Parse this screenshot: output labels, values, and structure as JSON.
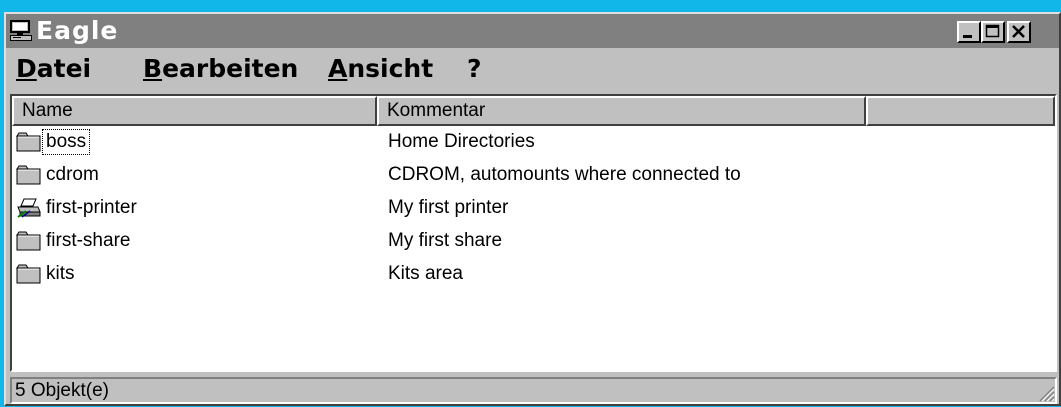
{
  "window": {
    "title": "Eagle"
  },
  "titlebar_buttons": {
    "minimize": "minimize-icon",
    "maximize": "maximize-icon",
    "close": "close-icon"
  },
  "menu": [
    "Datei",
    "Bearbeiten",
    "Ansicht",
    "?"
  ],
  "columns": [
    "Name",
    "Kommentar",
    ""
  ],
  "items": [
    {
      "name": "boss",
      "comment": "Home Directories",
      "icon": "folder-icon"
    },
    {
      "name": "cdrom",
      "comment": "CDROM, automounts where connected to",
      "icon": "folder-icon"
    },
    {
      "name": "first-printer",
      "comment": "My first printer",
      "icon": "printer-icon"
    },
    {
      "name": "first-share",
      "comment": "My first share",
      "icon": "folder-icon"
    },
    {
      "name": "kits",
      "comment": "Kits area",
      "icon": "folder-icon"
    }
  ],
  "status": {
    "text": "5 Objekt(e)"
  },
  "colors": {
    "desktop": "#11b7e8",
    "titlebar_inactive": "#808080",
    "face": "#c0c0c0"
  }
}
